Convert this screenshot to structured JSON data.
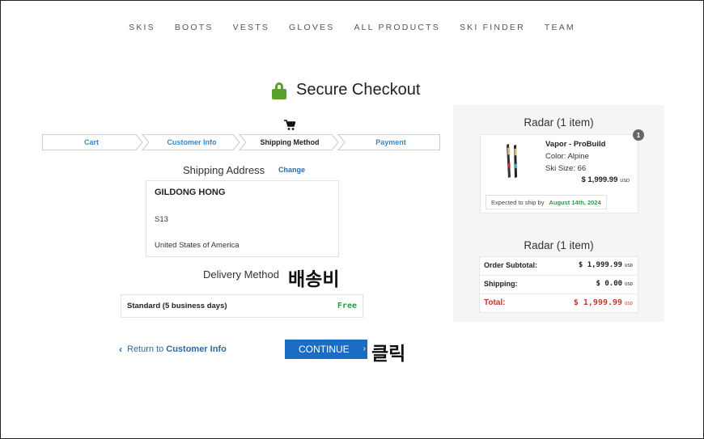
{
  "nav": [
    "SKIS",
    "BOOTS",
    "VESTS",
    "GLOVES",
    "ALL PRODUCTS",
    "SKI FINDER",
    "TEAM"
  ],
  "page_title": "Secure Checkout",
  "steps": [
    "Cart",
    "Customer Info",
    "Shipping Method",
    "Payment"
  ],
  "active_step": "Shipping Method",
  "shipping_address": {
    "heading": "Shipping Address",
    "change_label": "Change",
    "name": "GILDONG HONG",
    "line1": "S13",
    "country": "United States of America"
  },
  "delivery": {
    "heading": "Delivery Method",
    "annotation": "배송비",
    "option": "Standard (5 business days)",
    "price": "Free"
  },
  "actions": {
    "return_prefix": "Return to",
    "return_target": "Customer Info",
    "continue_label": "CONTINUE",
    "annotation": "클릭"
  },
  "sidebar": {
    "title": "Radar (1 item)",
    "item_count_badge": "1",
    "item": {
      "name": "Vapor - ProBuild",
      "color": "Color: Alpine",
      "size": "Ski Size: 66",
      "price": "$ 1,999.99",
      "currency": "USD",
      "ship_prefix": "Expected to ship by",
      "ship_date": "August 14th, 2024"
    },
    "summary_title": "Radar (1 item)",
    "summary": [
      {
        "label": "Order Subtotal:",
        "value": "$ 1,999.99",
        "currency": "USD"
      },
      {
        "label": "Shipping:",
        "value": "$ 0.00",
        "currency": "USD"
      },
      {
        "label": "Total:",
        "value": "$ 1,999.99",
        "currency": "USD"
      }
    ]
  },
  "colors": {
    "accent_blue": "#1a6cc4",
    "link_blue": "#2a6ca6",
    "lock_green": "#5aa02c",
    "free_green": "#2e9a48",
    "total_red": "#c0392b"
  }
}
